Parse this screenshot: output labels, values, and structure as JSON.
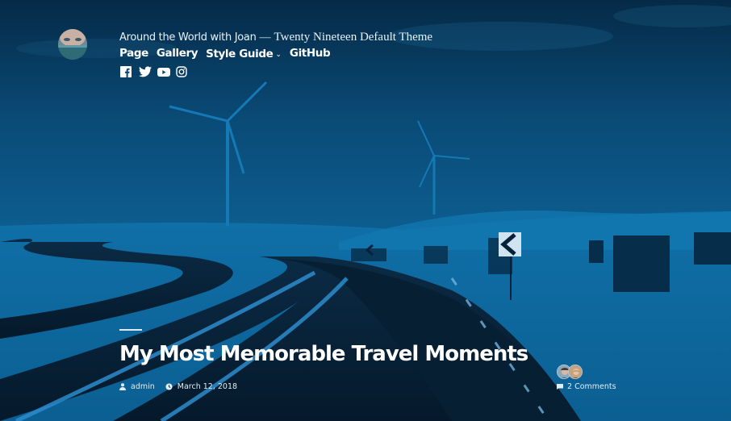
{
  "site": {
    "title": "Around the World with Joan",
    "separator": "—",
    "description": "Twenty Nineteen Default Theme"
  },
  "nav": {
    "items": [
      {
        "label": "Page"
      },
      {
        "label": "Gallery"
      },
      {
        "label": "Style Guide",
        "has_submenu": true
      },
      {
        "label": "GitHub"
      }
    ]
  },
  "social": [
    {
      "icon": "facebook-icon"
    },
    {
      "icon": "twitter-icon"
    },
    {
      "icon": "youtube-icon"
    },
    {
      "icon": "instagram-icon"
    }
  ],
  "entry": {
    "title": "My Most Memorable Travel Moments",
    "author": "admin",
    "date": "March 12, 2018",
    "comments": "2 Comments",
    "commenter_count": 2
  },
  "colors": {
    "overlay": "#0b4f7d",
    "text": "#ffffff"
  }
}
